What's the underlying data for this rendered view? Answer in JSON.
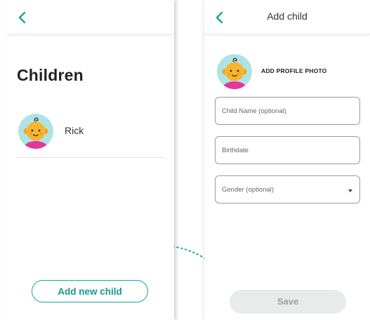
{
  "colors": {
    "accent": "#1aa39c",
    "disabled_bg": "#e8eaeb",
    "disabled_text": "#9b9fa2",
    "avatar_bg": "#aee3e6",
    "avatar_face": "#f7b52c",
    "avatar_shirt": "#e0389b"
  },
  "icons": {
    "back": "chevron-left-icon",
    "avatar": "baby-avatar-icon",
    "dropdown": "caret-down-icon",
    "connector": "dotted-arrow-icon"
  },
  "children_screen": {
    "title": "Children",
    "children": [
      {
        "name": "Rick"
      }
    ],
    "add_button_label": "Add new child"
  },
  "add_child_screen": {
    "title": "Add child",
    "add_photo_label": "ADD PROFILE PHOTO",
    "fields": {
      "child_name": {
        "placeholder": "Child Name (optional)",
        "value": ""
      },
      "birthdate": {
        "placeholder": "Birthdate",
        "value": ""
      },
      "gender": {
        "placeholder": "Gender (optional)",
        "value": ""
      }
    },
    "save_label": "Save"
  }
}
